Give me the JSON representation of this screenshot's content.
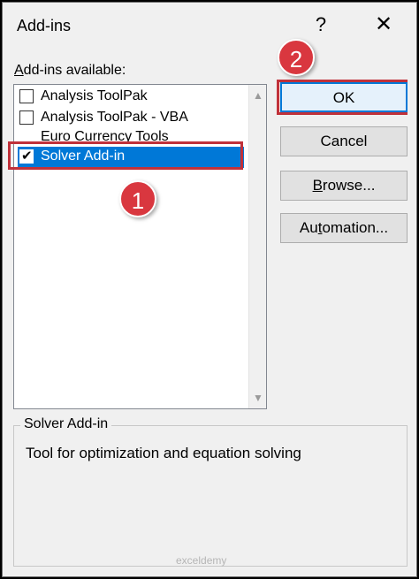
{
  "dialog": {
    "title": "Add-ins",
    "help_label": "?",
    "close_label": "✕"
  },
  "addins_label_prefix": "A",
  "addins_label_rest": "dd-ins available:",
  "addins": [
    {
      "label": "Analysis ToolPak",
      "checked": false
    },
    {
      "label": "Analysis ToolPak - VBA",
      "checked": false
    },
    {
      "label": "Euro Currency Tools",
      "checked": false
    },
    {
      "label": "Solver Add-in",
      "checked": true,
      "selected": true
    }
  ],
  "scroll": {
    "up": "▲",
    "down": "▼"
  },
  "buttons": {
    "ok": "OK",
    "cancel": "Cancel",
    "browse_prefix": "B",
    "browse_rest": "rowse...",
    "automation_prefix": "Au",
    "automation_u": "t",
    "automation_rest": "omation..."
  },
  "callouts": {
    "one": "1",
    "two": "2",
    "color": "#d9373f"
  },
  "description": {
    "group_label": "Solver Add-in",
    "text": "Tool for optimization and equation solving"
  },
  "watermark": "exceldemy"
}
